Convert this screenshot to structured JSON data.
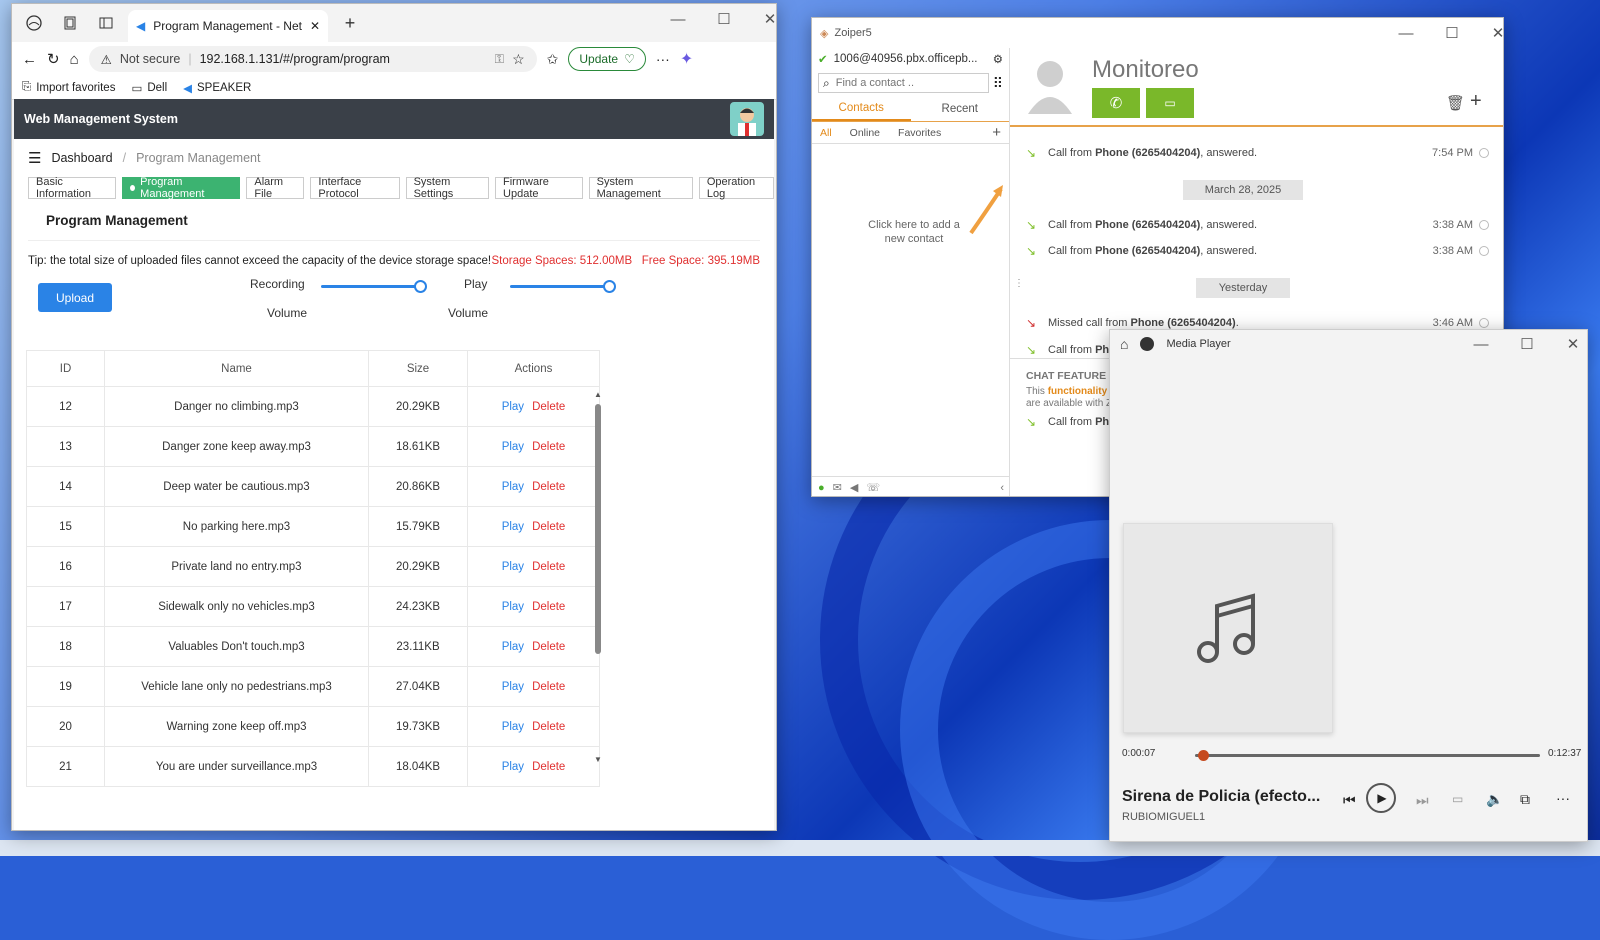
{
  "browser": {
    "tab_title": "Program Management - Network",
    "not_secure": "Not secure",
    "url": "192.168.1.131/#/program/program",
    "update_label": "Update",
    "favorites": [
      "Import favorites",
      "Dell",
      "SPEAKER"
    ]
  },
  "app": {
    "title": "Web Management System",
    "breadcrumb": {
      "root": "Dashboard",
      "current": "Program Management"
    },
    "tabs": [
      "Basic Information",
      "Program Management",
      "Alarm File",
      "Interface Protocol",
      "System Settings",
      "Firmware Update",
      "System Management",
      "Operation Log"
    ],
    "section_title": "Program Management",
    "tip": "Tip: the total size of uploaded files cannot exceed the capacity of the device storage space!",
    "storage": "Storage Spaces: 512.00MB",
    "free": "Free Space: 395.19MB",
    "upload_label": "Upload",
    "recording_label": "Recording",
    "play_label": "Play",
    "volume_label": "Volume",
    "recording_volume": 1.0,
    "play_volume": 1.0,
    "table": {
      "headers": [
        "ID",
        "Name",
        "Size",
        "Actions"
      ],
      "play": "Play",
      "delete": "Delete",
      "rows": [
        {
          "id": "12",
          "name": "Danger no climbing.mp3",
          "size": "20.29KB"
        },
        {
          "id": "13",
          "name": "Danger zone keep away.mp3",
          "size": "18.61KB"
        },
        {
          "id": "14",
          "name": "Deep water be cautious.mp3",
          "size": "20.86KB"
        },
        {
          "id": "15",
          "name": "No parking here.mp3",
          "size": "15.79KB"
        },
        {
          "id": "16",
          "name": "Private land no entry.mp3",
          "size": "20.29KB"
        },
        {
          "id": "17",
          "name": "Sidewalk only no vehicles.mp3",
          "size": "24.23KB"
        },
        {
          "id": "18",
          "name": "Valuables Don't touch.mp3",
          "size": "23.11KB"
        },
        {
          "id": "19",
          "name": "Vehicle lane only no pedestrians.mp3",
          "size": "27.04KB"
        },
        {
          "id": "20",
          "name": "Warning zone keep off.mp3",
          "size": "19.73KB"
        },
        {
          "id": "21",
          "name": "You are under surveillance.mp3",
          "size": "18.04KB"
        }
      ]
    }
  },
  "zoiper": {
    "title": "Zoiper5",
    "account": "1006@40956.pbx.officepb...",
    "search_placeholder": "Find a contact ..",
    "tabs": [
      "Contacts",
      "Recent"
    ],
    "filters": [
      "All",
      "Online",
      "Favorites"
    ],
    "empty_hint": "Click here to add a new contact",
    "contact_name": "Monitoreo",
    "calls": [
      {
        "text": "Call from",
        "who": "Phone (6265404204)",
        "tail": ", answered.",
        "time": "7:54 PM"
      },
      {
        "text": "Call from",
        "who": "Phone (6265404204)",
        "tail": ", answered.",
        "time": "3:38 AM"
      },
      {
        "text": "Call from",
        "who": "Phone (6265404204)",
        "tail": ", answered.",
        "time": "3:38 AM"
      },
      {
        "text": "Missed call from",
        "who": "Phone (6265404204)",
        "tail": ".",
        "time": "3:46 AM"
      },
      {
        "text": "Call from",
        "who": "Ph",
        "tail": "",
        "time": ""
      },
      {
        "text": "Call from",
        "who": "Ph",
        "tail": "",
        "time": ""
      }
    ],
    "dates": [
      "March 28, 2025",
      "Yesterday"
    ],
    "chat_title": "CHAT FEATURE IS",
    "chat_body1": "This",
    "chat_hl": "functionality",
    "chat_body2": "are available with Z"
  },
  "media": {
    "title": "Media Player",
    "elapsed": "0:00:07",
    "total": "0:12:37",
    "progress": 0.01,
    "track": "Sirena de Policia (efecto...",
    "artist": "RUBIOMIGUEL1"
  }
}
